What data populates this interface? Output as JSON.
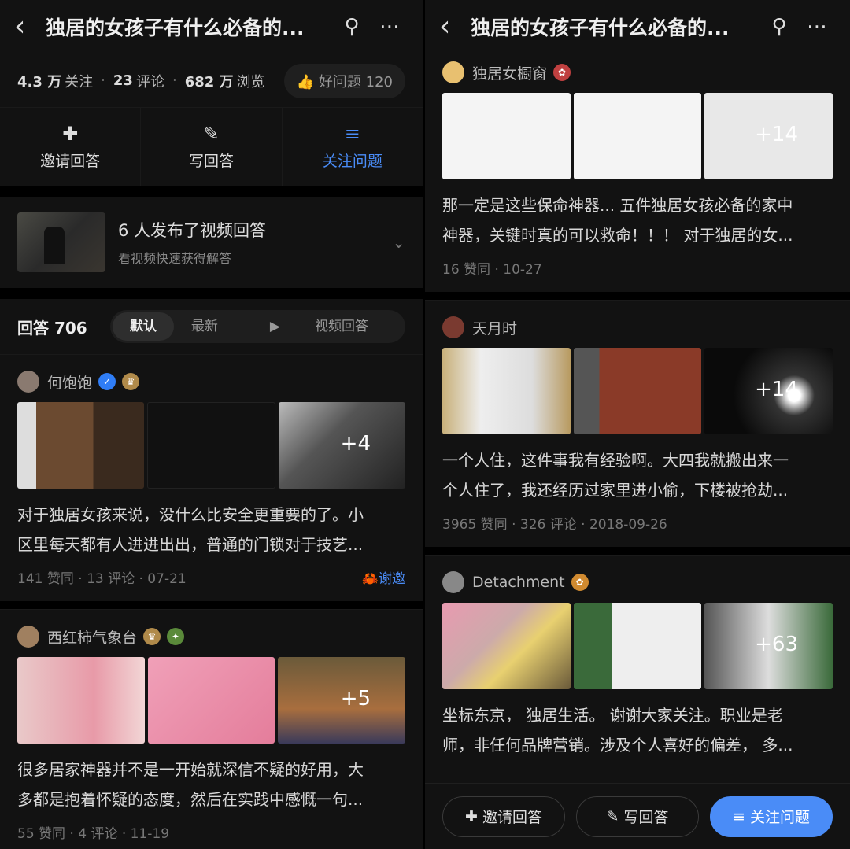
{
  "left": {
    "title": "独居的女孩子有什么必备的...",
    "stats": {
      "followers": "4.3 万",
      "followers_label": "关注",
      "comments": "23",
      "comments_label": "评论",
      "views": "682 万",
      "views_label": "浏览",
      "good_question": "好问题 120"
    },
    "actions": [
      "邀请回答",
      "写回答",
      "关注问题"
    ],
    "video": {
      "title": "6 人发布了视频回答",
      "subtitle": "看视频快速获得解答"
    },
    "answers_header": {
      "label": "回答 706",
      "tabs": [
        "默认",
        "最新",
        "视频回答"
      ]
    },
    "answers": [
      {
        "author": "何饱饱",
        "more": "+4",
        "excerpt_1": "对于独居女孩来说，没什么比安全更重要的了。小",
        "excerpt_2": "区里每天都有人进进出出，普通的门锁对于技艺...",
        "meta": "141 赞同 · 13 评论 · 07-21",
        "thanks": "谢邀"
      },
      {
        "author": "西红柿气象台",
        "more": "+5",
        "excerpt_1": "很多居家神器并不是一开始就深信不疑的好用，大",
        "excerpt_2": "多都是抱着怀疑的态度，然后在实践中感慨一句...",
        "meta": "55 赞同 · 4 评论 · 11-19"
      }
    ]
  },
  "right": {
    "title": "独居的女孩子有什么必备的...",
    "answers": [
      {
        "author": "独居女橱窗",
        "more": "+14",
        "excerpt_1": "那一定是这些保命神器... 五件独居女孩必备的家中",
        "excerpt_2": "神器，关键时真的可以救命！！！ 对于独居的女...",
        "meta": "16 赞同 · 10-27"
      },
      {
        "author": "天月时",
        "more": "+14",
        "excerpt_1": "一个人住，这件事我有经验啊。大四我就搬出来一",
        "excerpt_2": "个人住了，我还经历过家里进小偷，下楼被抢劫...",
        "meta": "3965 赞同 · 326 评论 · 2018-09-26"
      },
      {
        "author": "Detachment",
        "more": "+63",
        "excerpt_1": "坐标东京， 独居生活。 谢谢大家关注。职业是老",
        "excerpt_2": "师，非任何品牌营销。涉及个人喜好的偏差， 多..."
      }
    ],
    "bottom": [
      "邀请回答",
      "写回答",
      "关注问题"
    ]
  },
  "colors": {
    "accent": "#4a8cf7",
    "video_orange": "#f0702e",
    "bg": "#121212"
  }
}
